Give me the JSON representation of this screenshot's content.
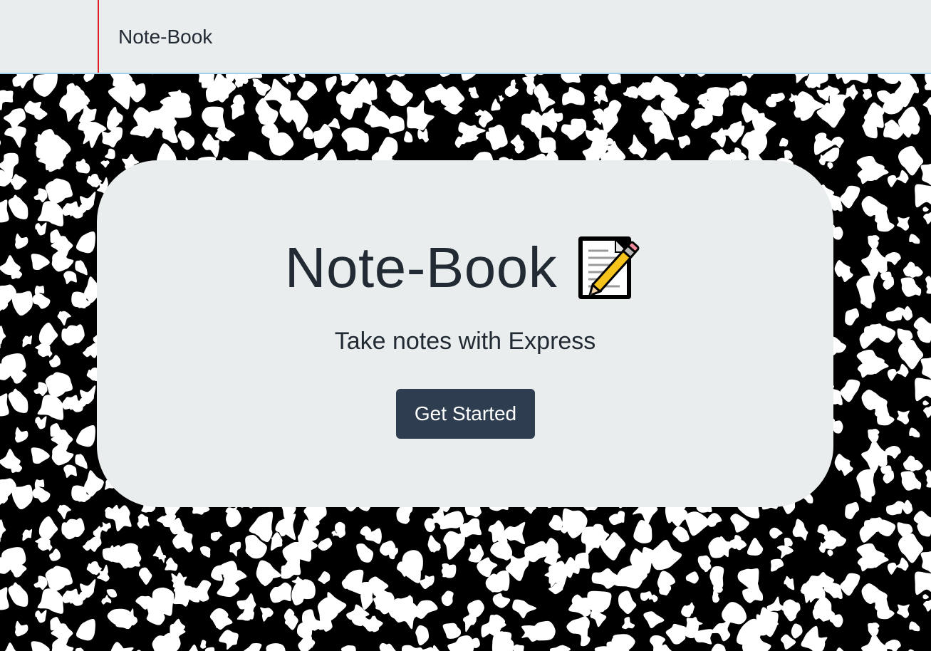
{
  "navbar": {
    "brand": "Note-Book"
  },
  "hero": {
    "title": "Note-Book",
    "title_icon": "memo-icon",
    "tagline": "Take notes with Express",
    "cta_label": "Get Started"
  },
  "colors": {
    "panel": "#e9edee",
    "text": "#222a33",
    "button": "#2e3e50",
    "margin_line": "#e02020",
    "header_rule": "#9fd0e6",
    "cover_dark": "#000000",
    "cover_light": "#ffffff"
  }
}
